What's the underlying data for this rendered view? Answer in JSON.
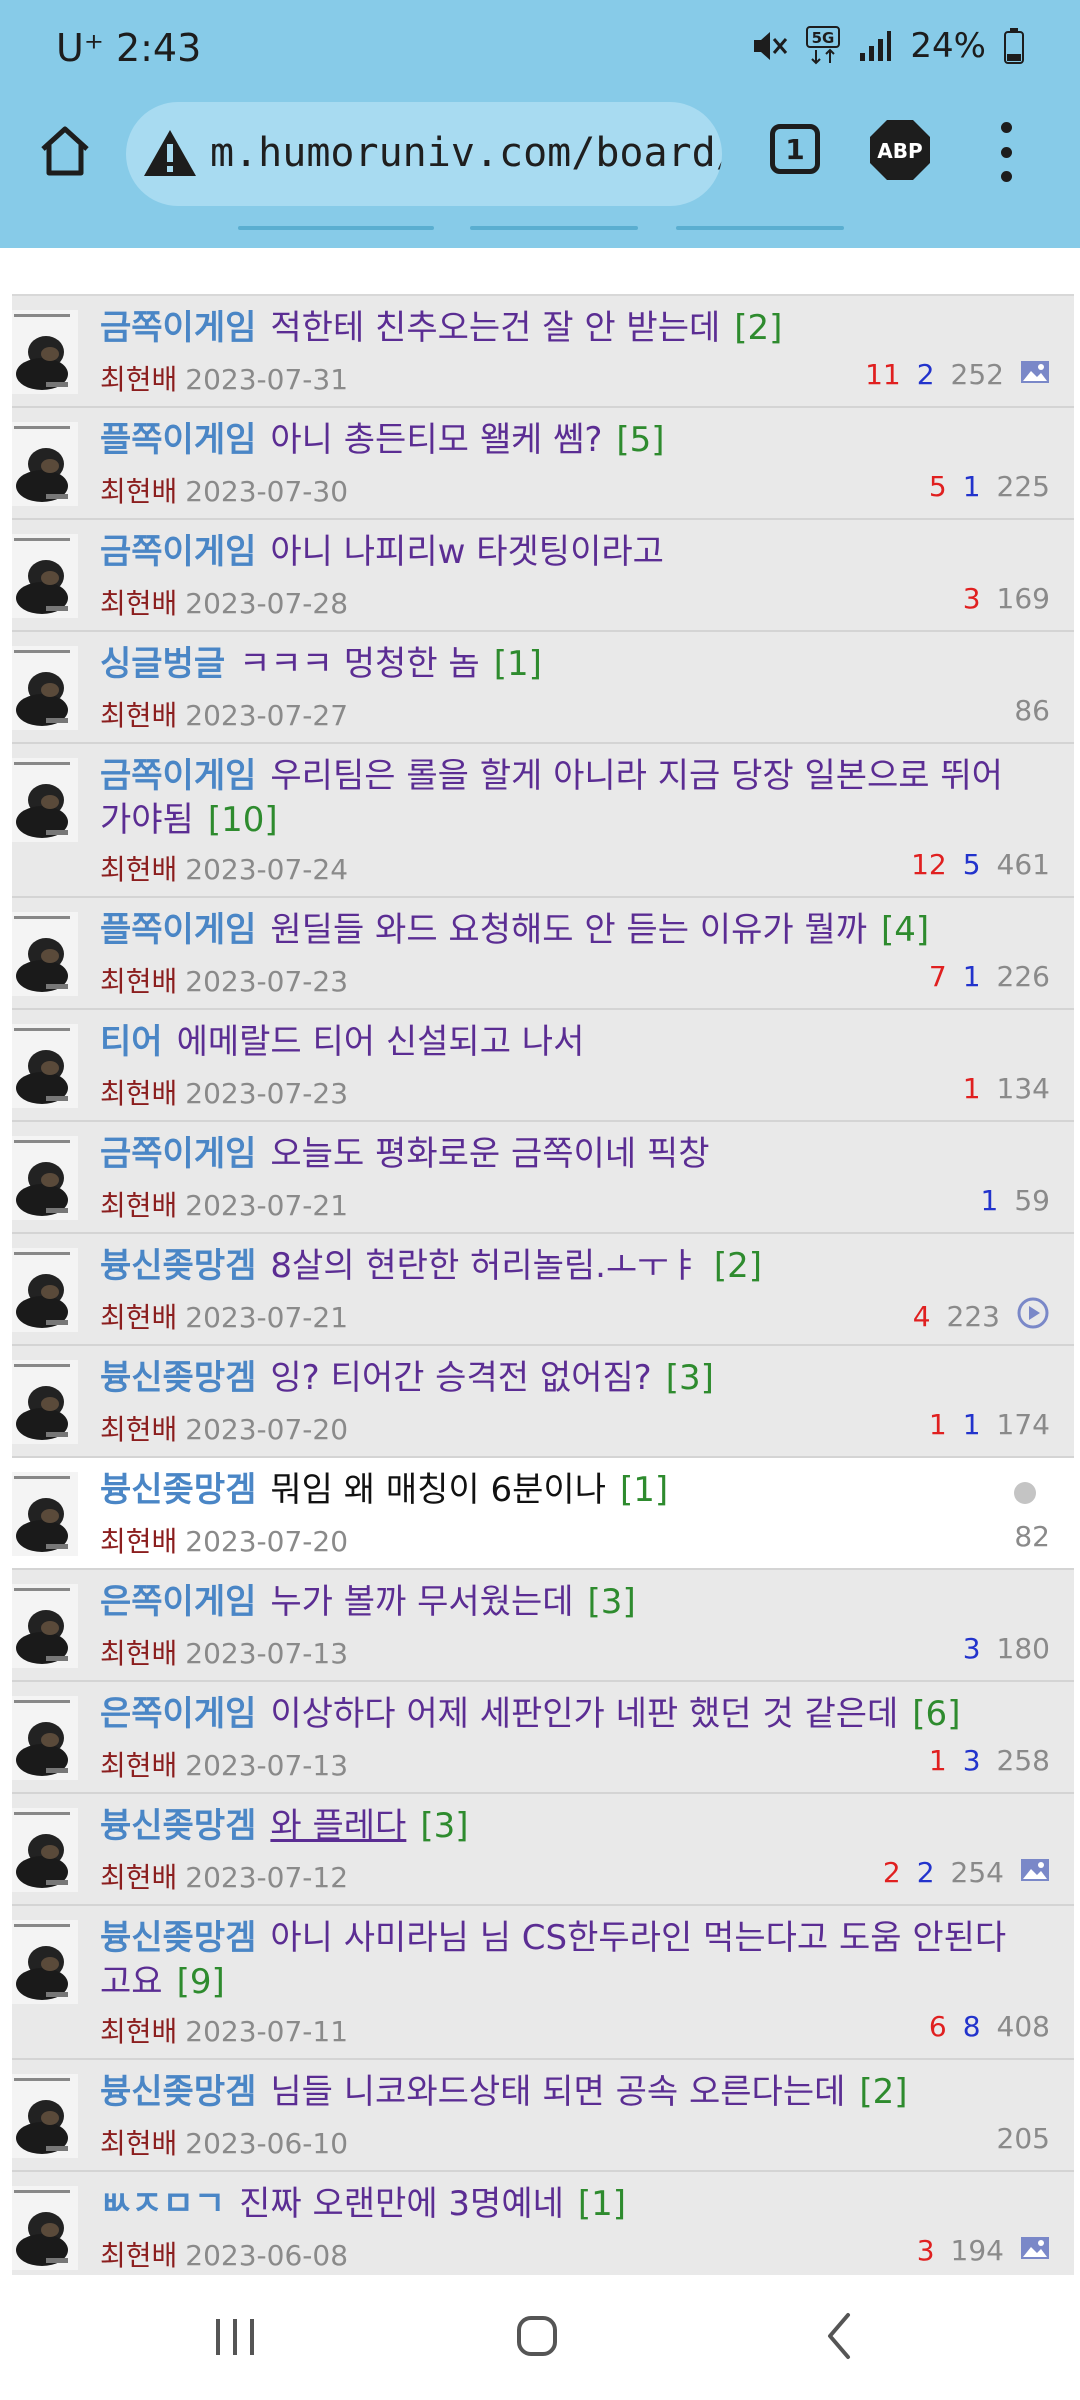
{
  "status_bar": {
    "carrier_time": "U⁺ 2:43",
    "network": "5G",
    "battery": "24%"
  },
  "browser": {
    "url": "m.humoruniv.com/board/lis",
    "tab_count": "1",
    "adblock_label": "ABP"
  },
  "posts": [
    {
      "category": "금쪽이게임",
      "title": "적한테 친추오는건 잘 안 받는데",
      "comments": "[2]",
      "author": "최현배",
      "date": "2023-07-31",
      "up": "11",
      "down": "2",
      "views": "252",
      "icon": "image-icon"
    },
    {
      "category": "플쪽이게임",
      "title": "아니 총든티모 왤케 쎔?",
      "comments": "[5]",
      "author": "최현배",
      "date": "2023-07-30",
      "up": "5",
      "down": "1",
      "views": "225",
      "icon": ""
    },
    {
      "category": "금쪽이게임",
      "title": "아니 나피리w 타겟팅이라고",
      "comments": "",
      "author": "최현배",
      "date": "2023-07-28",
      "up": "3",
      "down": "",
      "views": "169",
      "icon": ""
    },
    {
      "category": "싱글벙글",
      "title": "ㅋㅋㅋ 멍청한 놈",
      "comments": "[1]",
      "author": "최현배",
      "date": "2023-07-27",
      "up": "",
      "down": "",
      "views": "86",
      "icon": ""
    },
    {
      "category": "금쪽이게임",
      "title": "우리팀은 롤을 할게 아니라 지금 당장 일본으로 뛰어가야됨",
      "comments": "[10]",
      "author": "최현배",
      "date": "2023-07-24",
      "up": "12",
      "down": "5",
      "views": "461",
      "icon": ""
    },
    {
      "category": "플쪽이게임",
      "title": "원딜들 와드 요청해도 안 듣는 이유가 뭘까",
      "comments": "[4]",
      "author": "최현배",
      "date": "2023-07-23",
      "up": "7",
      "down": "1",
      "views": "226",
      "icon": ""
    },
    {
      "category": "티어",
      "title": "에메랄드 티어 신설되고 나서",
      "comments": "",
      "author": "최현배",
      "date": "2023-07-23",
      "up": "1",
      "down": "",
      "views": "134",
      "icon": ""
    },
    {
      "category": "금쪽이게임",
      "title": "오늘도 평화로운 금쪽이네 픽창",
      "comments": "",
      "author": "최현배",
      "date": "2023-07-21",
      "up": "",
      "down": "1",
      "views": "59",
      "icon": ""
    },
    {
      "category": "븅신좆망겜",
      "title": "8살의 현란한 허리놀림.ㅗㅜㅑ",
      "comments": "[2]",
      "author": "최현배",
      "date": "2023-07-21",
      "up": "4",
      "down": "",
      "views": "223",
      "icon": "video-icon"
    },
    {
      "category": "븅신좆망겜",
      "title": "잉? 티어간 승격전 없어짐?",
      "comments": "[3]",
      "author": "최현배",
      "date": "2023-07-20",
      "up": "1",
      "down": "1",
      "views": "174",
      "icon": ""
    },
    {
      "category": "븅신좆망겜",
      "title": "뭐임 왜 매칭이 6분이나",
      "comments": "[1]",
      "author": "최현배",
      "date": "2023-07-20",
      "up": "",
      "down": "",
      "views": "82",
      "icon": "",
      "unread": true
    },
    {
      "category": "은쪽이게임",
      "title": "누가 볼까 무서웠는데",
      "comments": "[3]",
      "author": "최현배",
      "date": "2023-07-13",
      "up": "",
      "down": "3",
      "views": "180",
      "icon": ""
    },
    {
      "category": "은쪽이게임",
      "title": "이상하다 어제 세판인가 네판 했던 것 같은데",
      "comments": "[6]",
      "author": "최현배",
      "date": "2023-07-13",
      "up": "1",
      "down": "3",
      "views": "258",
      "icon": ""
    },
    {
      "category": "븅신좆망겜",
      "title": "와 플레다",
      "comments": "[3]",
      "author": "최현배",
      "date": "2023-07-12",
      "up": "2",
      "down": "2",
      "views": "254",
      "icon": "image-icon",
      "link": true
    },
    {
      "category": "븅신좆망겜",
      "title": "아니 사미라님 님 CS한두라인 먹는다고 도움 안된다고요",
      "comments": "[9]",
      "author": "최현배",
      "date": "2023-07-11",
      "up": "6",
      "down": "8",
      "views": "408",
      "icon": ""
    },
    {
      "category": "븅신좆망겜",
      "title": "님들 니코와드상태 되면 공속 오른다는데",
      "comments": "[2]",
      "author": "최현배",
      "date": "2023-06-10",
      "up": "",
      "down": "",
      "views": "205",
      "icon": ""
    },
    {
      "category": "ㅄㅈㅁㄱ",
      "title": "진짜 오랜만에 3명예네",
      "comments": "[1]",
      "author": "최현배",
      "date": "2023-06-08",
      "up": "3",
      "down": "",
      "views": "194",
      "icon": "image-icon"
    }
  ],
  "colors": {
    "chrome": "#87cbe8",
    "category": "#4a86c6",
    "title": "#5b2d93",
    "comments": "#2e8b2e",
    "author": "#8b1e1e",
    "upvote": "#e02020",
    "downvote": "#2233cc"
  },
  "nav": {
    "recent": "recent-apps-icon",
    "home": "home-icon",
    "back": "back-icon"
  }
}
